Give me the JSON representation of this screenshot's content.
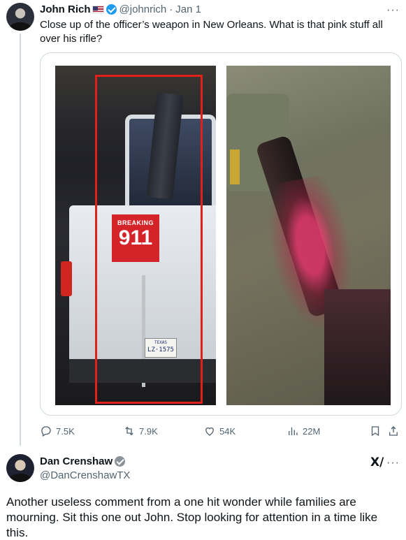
{
  "post": {
    "author_name": "John Rich",
    "handle": "@johnrich",
    "separator": "·",
    "time": "Jan 1",
    "more_label": "···",
    "text": "Close up of the officer’s weapon in New Orleans. What is that pink stuff all over his rifle?",
    "media": {
      "logo_top": "BREAKING",
      "logo_number": "911",
      "plate_state": "TEXAS",
      "plate_number": "LZ·1575"
    },
    "actions": {
      "replies": "7.5K",
      "reposts": "7.9K",
      "likes": "54K",
      "views": "22M"
    },
    "icons": {
      "reply": "reply-icon",
      "repost": "repost-icon",
      "like": "heart-icon",
      "views": "views-icon",
      "bookmark": "bookmark-icon",
      "share": "share-icon",
      "verified": "verified-badge-icon",
      "flag": "us-flag-icon"
    },
    "colors": {
      "verified": "#1d9bf0",
      "secondary_text": "#536471"
    }
  },
  "reply": {
    "author_name": "Dan Crenshaw",
    "handle": "@DanCrenshawTX",
    "grok_label": "X/",
    "more_label": "···",
    "text": "Another useless comment from a one hit wonder while families are mourning. Sit this one out John. Stop looking for attention in a time like this.",
    "colors": {
      "verified": "#8a929a"
    }
  }
}
